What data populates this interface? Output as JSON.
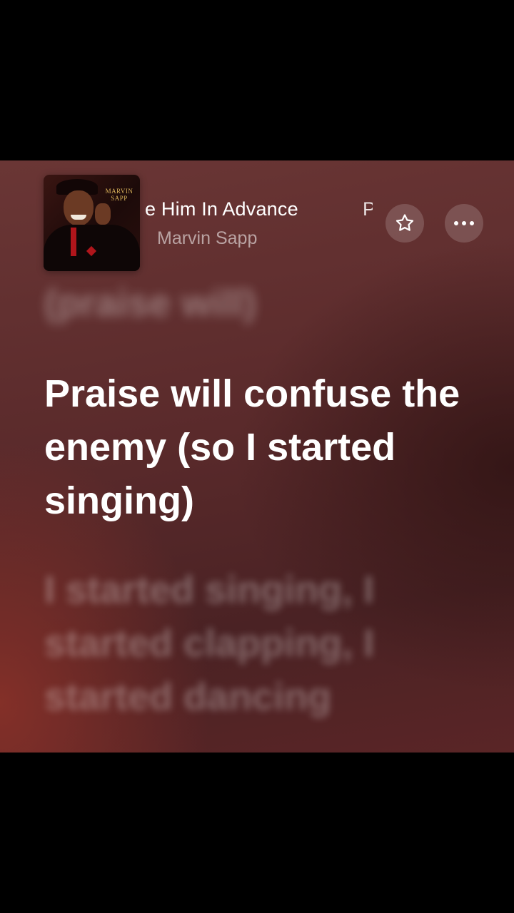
{
  "track": {
    "title_visible": "e Him In Advance",
    "title_peek": "P",
    "artist": "Marvin Sapp",
    "album_art_text": "MARVIN SAPP"
  },
  "controls": {
    "favorite_icon": "star-outline-icon",
    "more_icon": "ellipsis-icon"
  },
  "lyrics": {
    "previous": "(praise will)",
    "current": "Praise will confuse the enemy (so I started singing)",
    "next": "I started singing, I started clapping, I started dancing"
  }
}
